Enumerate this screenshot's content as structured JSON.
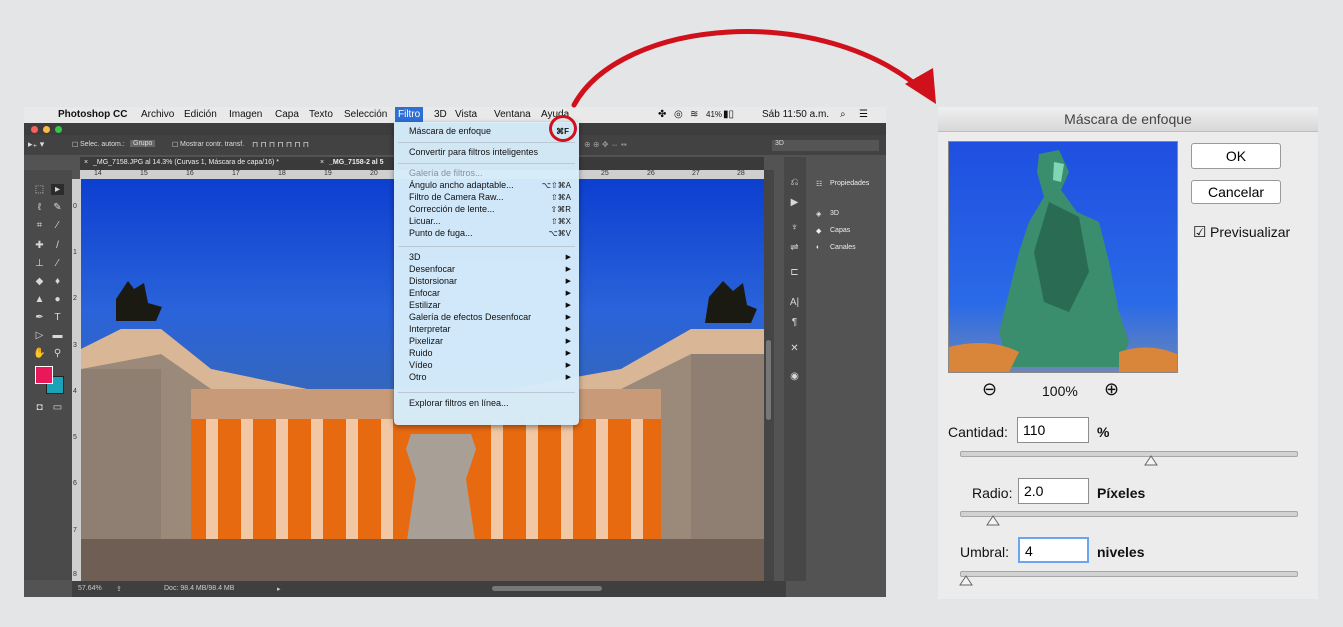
{
  "menubar": {
    "app_name": "Photoshop CC",
    "items": [
      "Archivo",
      "Edición",
      "Imagen",
      "Capa",
      "Texto",
      "Selección",
      "Filtro",
      "3D",
      "Vista",
      "Ventana",
      "Ayuda"
    ],
    "battery": "41%",
    "clock": "Sáb 11:50 a.m."
  },
  "options_bar": {
    "auto_select": "Selec. autom.:",
    "group": "Grupo",
    "show_controls": "Mostrar contr. transf.",
    "workspace": "3D"
  },
  "document_tabs": [
    "_MG_7158.JPG al 14.3% (Curvas 1, Máscara de capa/16) *",
    "_MG_7158-2 al 5"
  ],
  "ruler_top": [
    "14",
    "15",
    "16",
    "17",
    "18",
    "19",
    "20",
    "25",
    "26",
    "27",
    "28"
  ],
  "ruler_left": [
    "0",
    "1",
    "2",
    "3",
    "4",
    "5",
    "6",
    "7",
    "8"
  ],
  "status": {
    "zoom": "57.64%",
    "doc": "Doc: 98.4 MB/98.4 MB"
  },
  "panels": [
    "Propiedades",
    "3D",
    "Capas",
    "Canales"
  ],
  "filter_menu": {
    "last_filter": "Máscara de enfoque",
    "last_filter_shortcut": "⌘F",
    "smart": "Convertir para filtros inteligentes",
    "gallery": "Galería de filtros...",
    "items": [
      {
        "label": "Ángulo ancho adaptable...",
        "shortcut": "⌥⇧⌘A"
      },
      {
        "label": "Filtro de Camera Raw...",
        "shortcut": "⇧⌘A"
      },
      {
        "label": "Corrección de lente...",
        "shortcut": "⇧⌘R"
      },
      {
        "label": "Licuar...",
        "shortcut": "⇧⌘X"
      },
      {
        "label": "Punto de fuga...",
        "shortcut": "⌥⌘V"
      }
    ],
    "submenus": [
      "3D",
      "Desenfocar",
      "Distorsionar",
      "Enfocar",
      "Estilizar",
      "Galería de efectos Desenfocar",
      "Interpretar",
      "Pixelizar",
      "Ruido",
      "Vídeo",
      "Otro"
    ],
    "browse": "Explorar filtros en línea..."
  },
  "dialog": {
    "title": "Máscara de enfoque",
    "ok": "OK",
    "cancel": "Cancelar",
    "preview_label": "Previsualizar",
    "preview_checked": true,
    "zoom": "100%",
    "amount_label": "Cantidad:",
    "amount_value": "110",
    "amount_unit": "%",
    "radius_label": "Radio:",
    "radius_value": "2.0",
    "radius_unit": "Píxeles",
    "threshold_label": "Umbral:",
    "threshold_value": "4",
    "threshold_unit": "niveles"
  },
  "colors": {
    "annotation": "#d0101a",
    "foreground": "#e8185a",
    "background": "#1aa2b8"
  }
}
